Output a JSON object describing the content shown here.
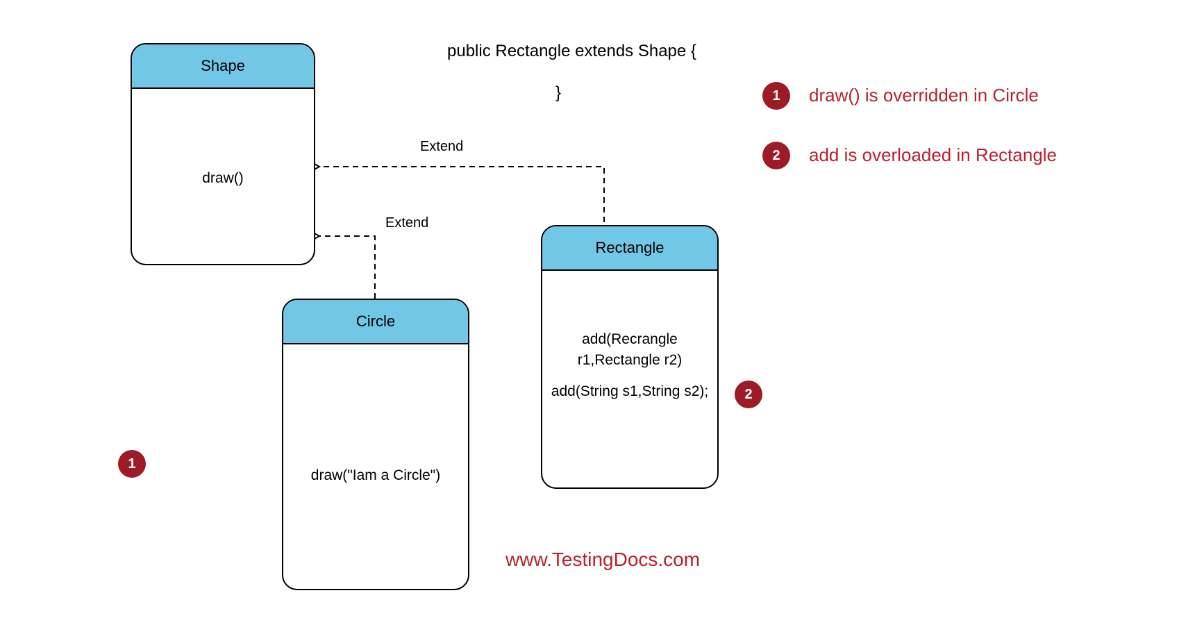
{
  "code_snippet": {
    "line1": "public Rectangle extends Shape {",
    "line2": "}"
  },
  "notes": {
    "n1": {
      "num": "1",
      "text": "draw() is overridden in Circle"
    },
    "n2": {
      "num": "2",
      "text": "add is overloaded in Rectangle"
    }
  },
  "classes": {
    "shape": {
      "name": "Shape",
      "methods": [
        "draw()"
      ]
    },
    "circle": {
      "name": "Circle",
      "methods": [
        "draw(\"Iam a Circle\")"
      ]
    },
    "rectangle": {
      "name": "Rectangle",
      "methods": [
        "add(Recrangle r1,Rectangle r2)",
        "add(String s1,String s2);"
      ]
    }
  },
  "edges": {
    "e1": "Extend",
    "e2": "Extend"
  },
  "markers": {
    "m1": "1",
    "m2": "2"
  },
  "website": "www.TestingDocs.com"
}
